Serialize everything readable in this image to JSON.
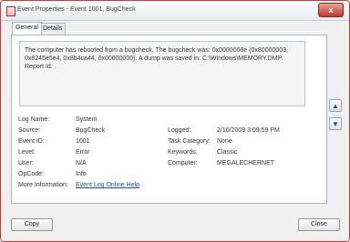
{
  "window": {
    "title": "Event Properties - Event 1001, BugCheck",
    "close_label": "x"
  },
  "tabs": [
    {
      "label": "General"
    },
    {
      "label": "Details"
    }
  ],
  "message": "The computer has rebooted from a bugcheck.  The bugcheck was: 0x0000008e (0x80000003, 0x8245e5e4, 0x8b4ca44, 0x00000000). A dump was saved in: C:\\Windows\\MEMORY.DMP. Report Id: .",
  "fields": {
    "log_name": {
      "label": "Log Name:",
      "value": "System"
    },
    "source": {
      "label": "Source:",
      "value": "BugCheck"
    },
    "logged": {
      "label": "Logged:",
      "value": "2/10/2009 3:09:59 PM"
    },
    "event_id": {
      "label": "Event ID:",
      "value": "1001"
    },
    "task_category": {
      "label": "Task Category:",
      "value": "None"
    },
    "level": {
      "label": "Level:",
      "value": "Error"
    },
    "keywords": {
      "label": "Keywords:",
      "value": "Classic"
    },
    "user": {
      "label": "User:",
      "value": "N/A"
    },
    "computer": {
      "label": "Computer:",
      "value": "MEGALECHERNET"
    },
    "opcode": {
      "label": "OpCode:",
      "value": "Info"
    },
    "more_info": {
      "label": "More Information:",
      "link": "Event Log Online Help"
    }
  },
  "nav": {
    "up_icon": "arrow-up-icon",
    "down_icon": "arrow-down-icon"
  },
  "buttons": {
    "copy": "Copy",
    "close": "Close"
  }
}
